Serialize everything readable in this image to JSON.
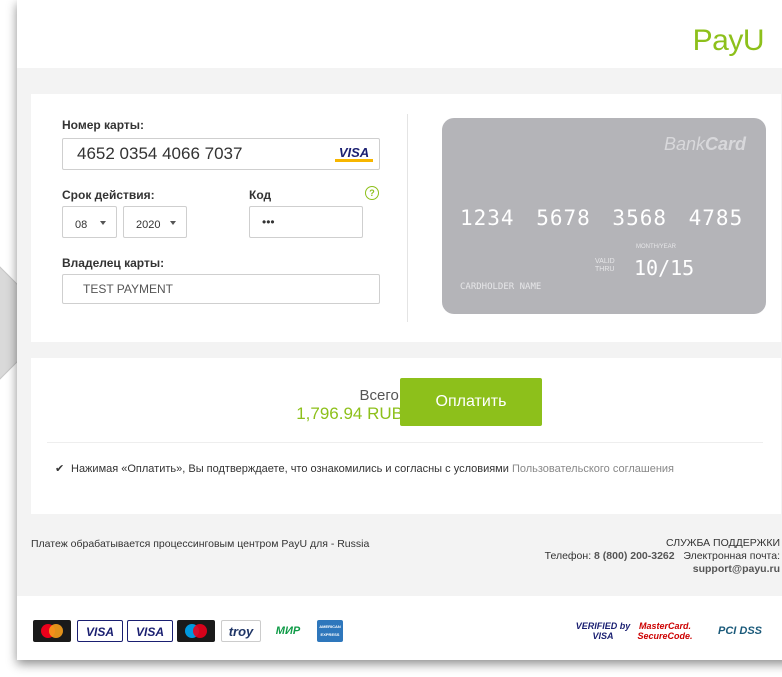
{
  "header": {
    "logo_text": "PayU"
  },
  "form": {
    "card_number_label": "Номер карты:",
    "card_number_value": "4652 0354 4066 7037",
    "card_brand_icon": "VISA",
    "expiry_label": "Срок действия:",
    "month_value": "08",
    "year_value": "2020",
    "cvv_label": "Код",
    "cvv_help": "?",
    "cvv_value": "•••",
    "owner_label": "Владелец карты:",
    "owner_value": "TEST PAYMENT"
  },
  "bank_card": {
    "brand_a": "Bank",
    "brand_b": "Card",
    "number": "1234 5678 3568 4785",
    "valid_a": "VALID",
    "valid_b": "THRU",
    "month_year": "MONTH/YEAR",
    "expiry": "10/15",
    "holder": "CARDHOLDER NAME",
    "color": "#b4b4b8"
  },
  "payment": {
    "total_label": "Всего:",
    "total_value": "1,796.94 RUB",
    "pay_button": "Оплатить",
    "agree_text": "Нажимая «Оплатить», Вы подтверждаете, что ознакомились и согласны с условиями ",
    "agree_link": "Пользовательского соглашения",
    "agree_checked": true
  },
  "footer": {
    "processing_text": "Платеж обрабатывается процессинговым центром PayU для - Russia",
    "support_title": "СЛУЖБА ПОДДЕРЖКИ",
    "phone_label": "Телефон: ",
    "phone_value": "8 (800) 200-3262",
    "email_label": "Электронная почта:",
    "email_value": "support@payu.ru"
  },
  "payment_logos": [
    "mastercard",
    "VISA",
    "VISA",
    "maestro",
    "troy",
    "МИР",
    "AMERICAN EXPRESS"
  ],
  "security_logos": [
    "VERIFIED by VISA",
    "MasterCard. SecureCode.",
    "PCI DSS"
  ],
  "colors": {
    "accent": "#8dc01b",
    "background": "#f3f3f3"
  }
}
